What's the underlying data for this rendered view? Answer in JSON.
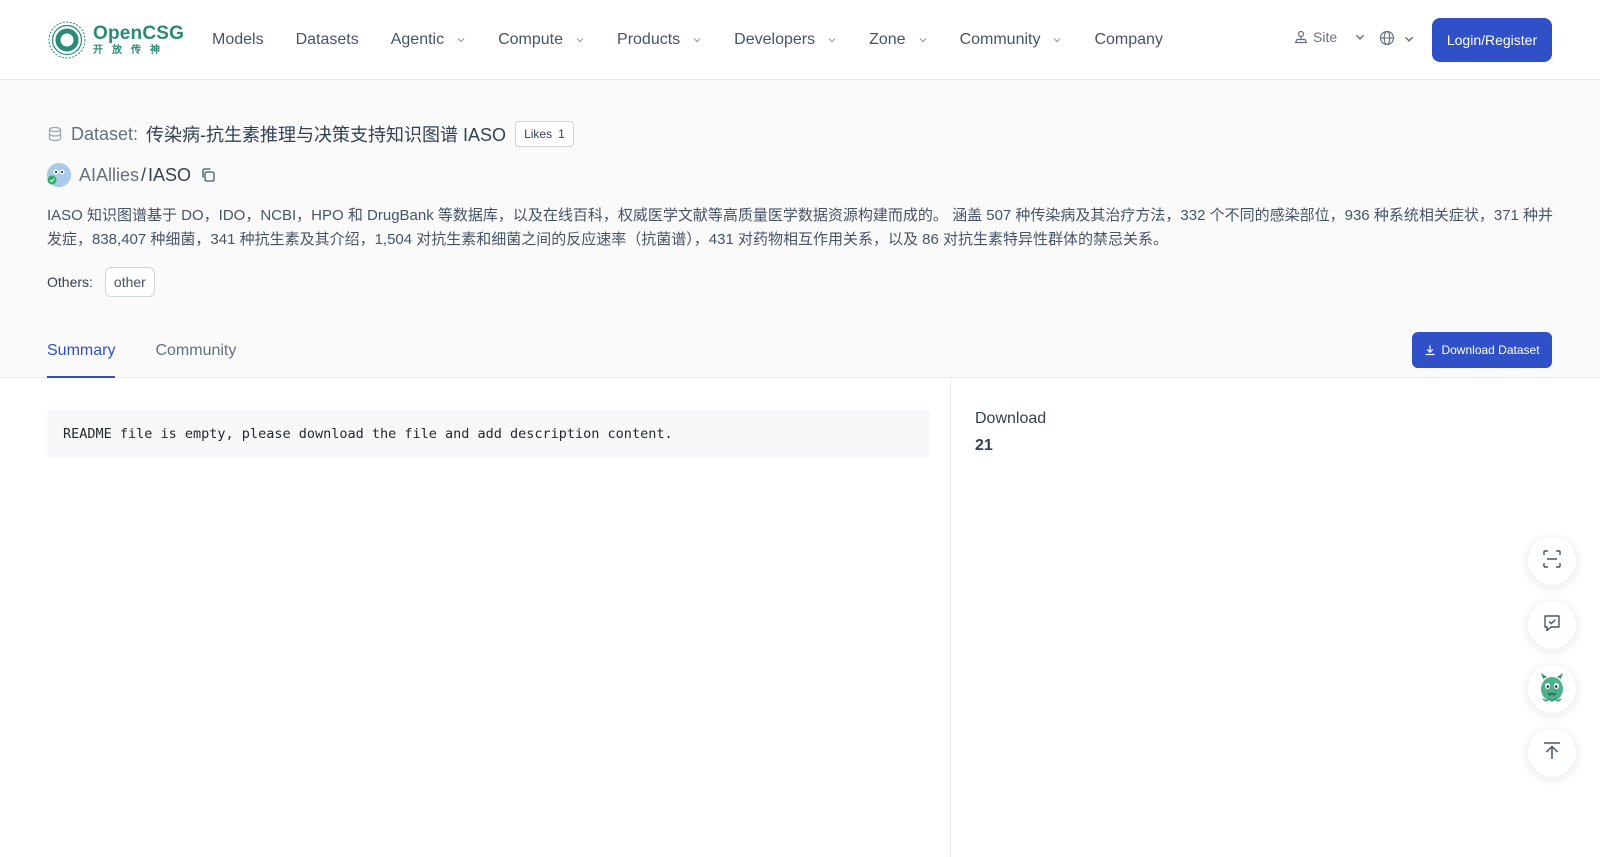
{
  "brand": {
    "name": "OpenCSG",
    "tagline": "开放传神",
    "color": "#2a8a77"
  },
  "nav": {
    "items": [
      {
        "label": "Models",
        "dropdown": false
      },
      {
        "label": "Datasets",
        "dropdown": false
      },
      {
        "label": "Agentic",
        "dropdown": true
      },
      {
        "label": "Compute",
        "dropdown": true
      },
      {
        "label": "Products",
        "dropdown": true
      },
      {
        "label": "Developers",
        "dropdown": true
      },
      {
        "label": "Zone",
        "dropdown": true
      },
      {
        "label": "Community",
        "dropdown": true
      },
      {
        "label": "Company",
        "dropdown": false
      }
    ],
    "site_label": "Site",
    "login_label": "Login/Register"
  },
  "dataset": {
    "type_label": "Dataset:",
    "name": "传染病-抗生素推理与决策支持知识图谱 IASO",
    "likes_label": "Likes",
    "likes_count": "1",
    "owner": "AIAllies",
    "separator": "/",
    "repo": "IASO",
    "description": "IASO 知识图谱基于 DO，IDO，NCBI，HPO 和 DrugBank 等数据库，以及在线百科，权威医学文献等高质量医学数据资源构建而成的。 涵盖 507 种传染病及其治疗方法，332 个不同的感染部位，936 种系统相关症状，371 种并发症，838,407 种细菌，341 种抗生素及其介绍，1,504 对抗生素和细菌之间的反应速率（抗菌谱），431 对药物相互作用关系，以及 86 对抗生素特异性群体的禁忌关系。",
    "others_label": "Others:",
    "tags": [
      "other"
    ]
  },
  "tabs": [
    {
      "label": "Summary",
      "active": true
    },
    {
      "label": "Community",
      "active": false
    }
  ],
  "download_button": "Download Dataset",
  "readme": {
    "text": "README file is empty, please download the file and add description content."
  },
  "sidebar": {
    "download_title": "Download",
    "download_count": "21"
  },
  "floating": [
    {
      "icon": "scan-icon"
    },
    {
      "icon": "feedback-check-icon"
    },
    {
      "icon": "mascot-icon"
    },
    {
      "icon": "back-to-top-icon"
    }
  ],
  "colors": {
    "primary": "#3050c8",
    "text": "#344054",
    "muted": "#667085",
    "band": "#fafafa"
  }
}
